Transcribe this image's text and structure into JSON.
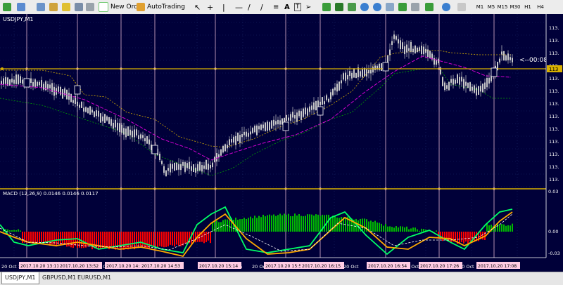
{
  "toolbar": {
    "new_order": "New Order",
    "auto_trading": "AutoTrading",
    "timeframes": [
      "M1",
      "M5",
      "M15",
      "M30",
      "H1",
      "H4"
    ],
    "icons": [
      "new-chart-icon",
      "profiles-icon",
      "market-watch-icon",
      "navigator-icon",
      "favorites-icon",
      "terminal-icon",
      "strategy-tester-icon",
      "new-order-icon",
      "autotrading-icon",
      "cursor-icon",
      "crosshair-icon",
      "vertical-line-icon",
      "horizontal-line-icon",
      "trendline-icon",
      "channel-icon",
      "fibonacci-icon",
      "text-icon",
      "arrow-icon",
      "bar-chart-icon",
      "candle-icon",
      "line-chart-icon",
      "zoom-in-icon",
      "zoom-out-icon",
      "tile-icon",
      "autoscroll-icon",
      "chart-shift-icon",
      "indicators-icon",
      "periods-icon",
      "templates-icon"
    ]
  },
  "chart": {
    "title": "USDJPY,M1",
    "countdown": "<--00:08",
    "price_axis_labels": [
      "113.",
      "113.",
      "113.",
      "113.",
      "113.",
      "113.",
      "113.",
      "113.",
      "113.",
      "113.",
      "113.",
      "113.",
      "113."
    ],
    "current_price_label": "113",
    "colors": {
      "background": "#000039",
      "candles": "#c8c8c8",
      "ma": "#d000d0",
      "upper": "#d8b000",
      "lower": "#00a000",
      "session_line": "#ffcce4"
    }
  },
  "macd": {
    "label": "MACD (12,26,9) 0.0146 0.0146 0.0117",
    "axis_labels": [
      "0.03",
      "0.00",
      "-0.03"
    ],
    "colors": {
      "hist_pos": "#00bb00",
      "hist_neg": "#ff0000",
      "line_main": "#00ff66",
      "line_signal": "#ffaa00"
    }
  },
  "time_axis": {
    "labels": [
      "20 Oct 1",
      "0:23",
      "0 Oct 1",
      "20 Oct 14:43",
      "5 15",
      "20 Oct 15:31",
      "20 Oct 16:19",
      "20 Oct",
      "0 Oct",
      "20 Oct"
    ],
    "session_labels": [
      "2017.10.20 13:11",
      "2017.10.20 13:52",
      "2017.10.20 14:33",
      "2017.10.20 14:53",
      "2017.10.20 15:14",
      "2017.10.20 15:55",
      "2017.10.20 16:15",
      "2017.10.20 16:54",
      "2017.10.20 17:26",
      "2017.10.20 17:08"
    ]
  },
  "tabs": [
    {
      "label": "USDJPY,M1",
      "active": true
    },
    {
      "label": "GBPUSD,M1",
      "active": false
    },
    {
      "label": "EURUSD,M1",
      "active": false
    }
  ]
}
